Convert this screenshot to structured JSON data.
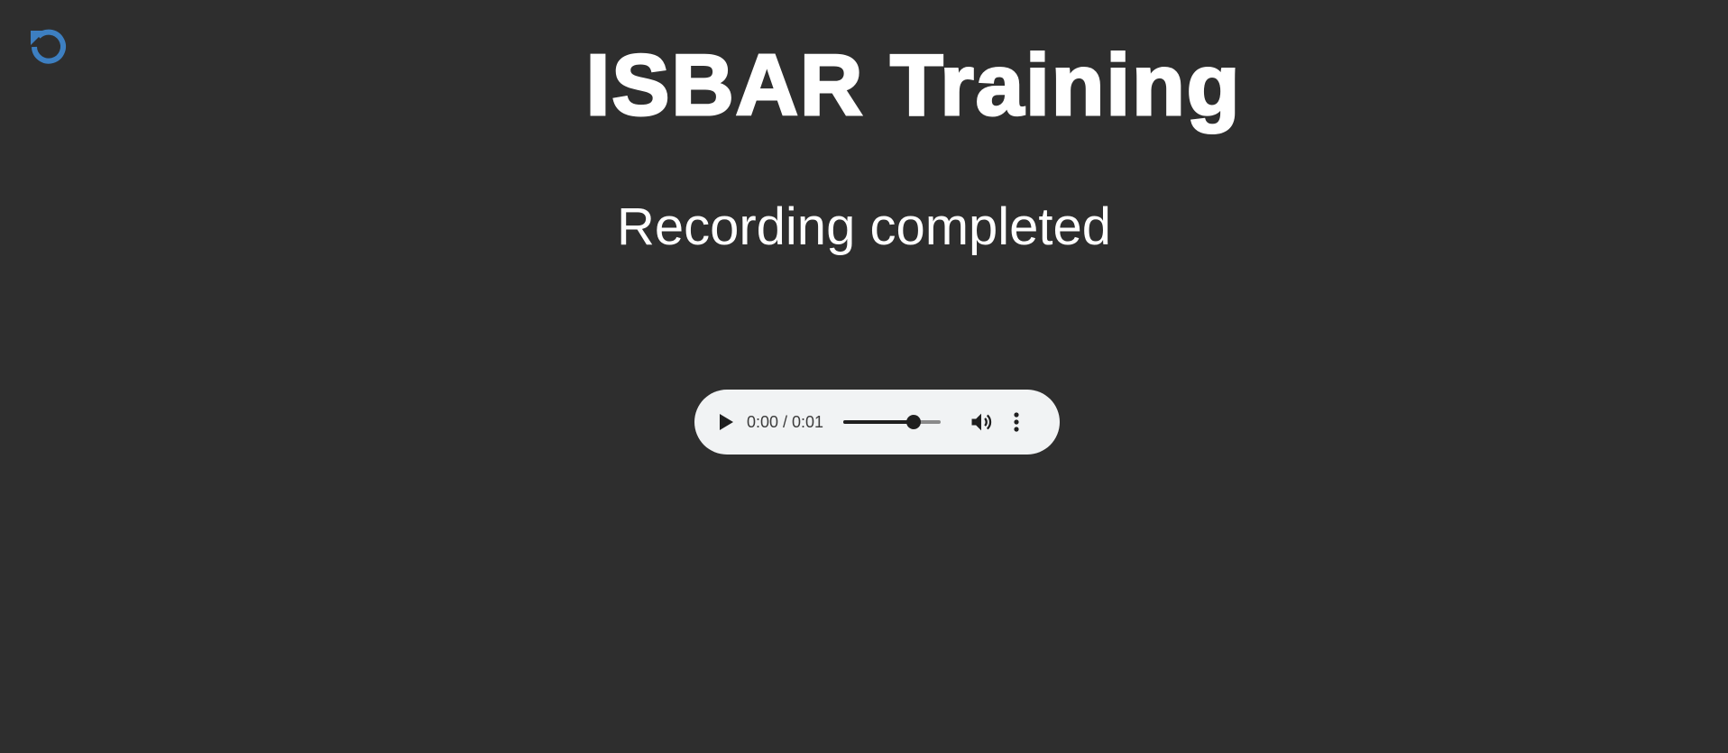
{
  "header": {
    "title": "ISBAR Training",
    "reset_icon": "reset-icon",
    "accent_color": "#3d7fc1"
  },
  "status": {
    "text": "Recording completed"
  },
  "audio_player": {
    "time": "0:00 / 0:01",
    "seek_progress": 0.72,
    "play_icon": "play-icon",
    "volume_icon": "volume-icon",
    "menu_icon": "more-vertical-icon"
  }
}
